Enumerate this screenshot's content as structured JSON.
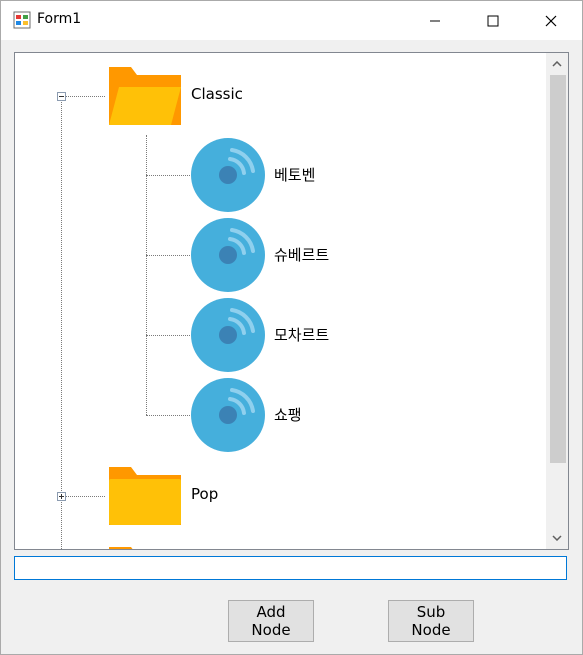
{
  "window": {
    "title": "Form1"
  },
  "tree": {
    "nodes": [
      {
        "label": "Classic",
        "expanded": true,
        "icon": "folder-open-icon",
        "children": [
          {
            "label": "베토벤",
            "icon": "disc-icon"
          },
          {
            "label": "슈베르트",
            "icon": "disc-icon"
          },
          {
            "label": "모차르트",
            "icon": "disc-icon"
          },
          {
            "label": "쇼팽",
            "icon": "disc-icon"
          }
        ]
      },
      {
        "label": "Pop",
        "expanded": false,
        "icon": "folder-icon",
        "children": []
      }
    ]
  },
  "input": {
    "value": ""
  },
  "buttons": {
    "add": "Add Node",
    "sub": "Sub Node"
  },
  "colors": {
    "folder": "#ffc107",
    "folder_tab": "#ff9800",
    "disc": "#45afdc",
    "disc_center": "#3b82b5",
    "focus": "#0078d7"
  }
}
